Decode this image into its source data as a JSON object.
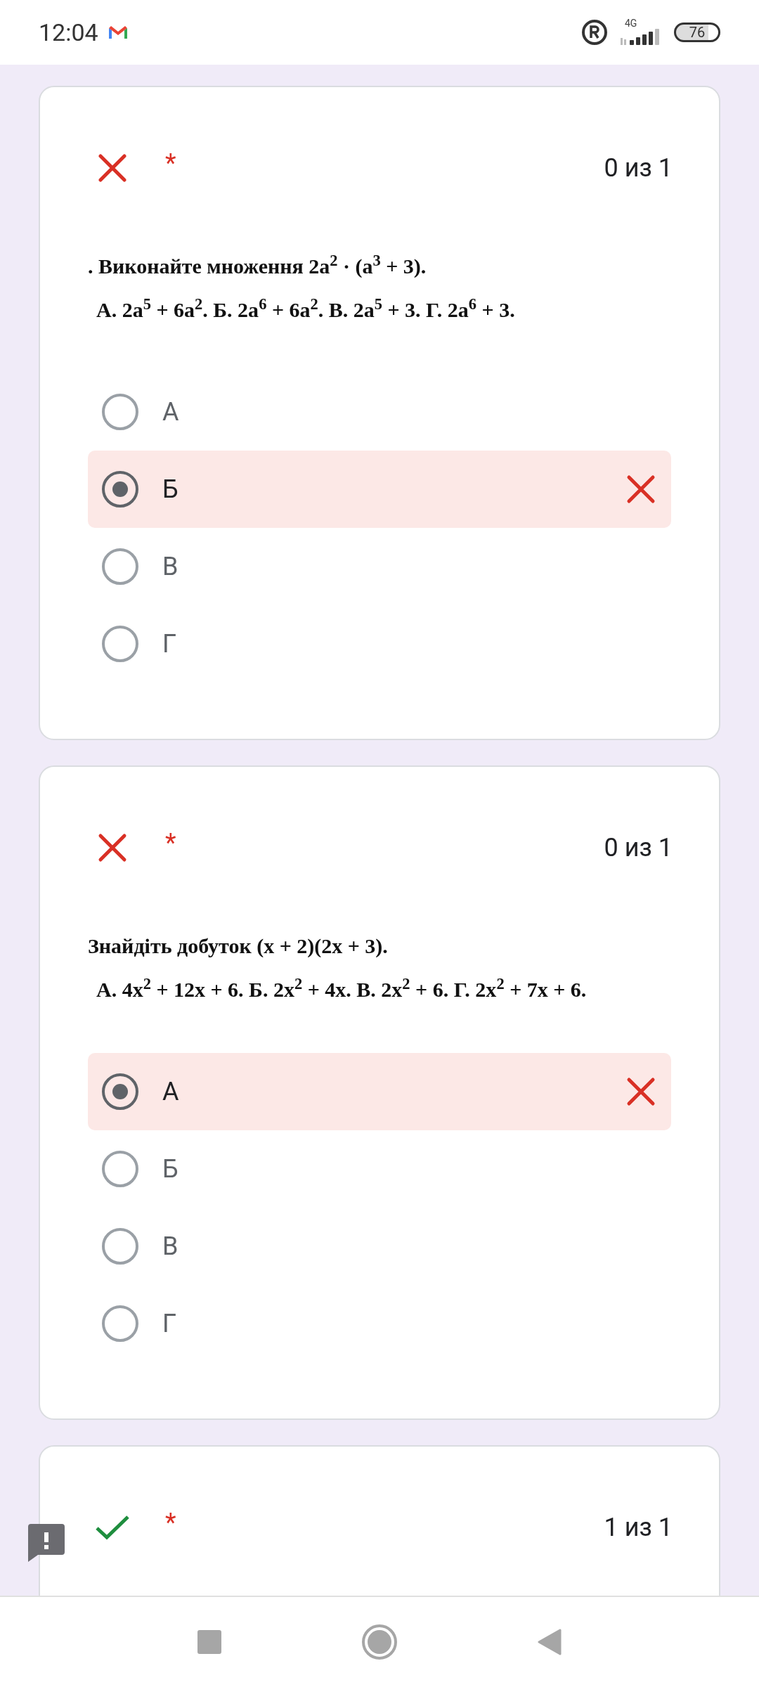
{
  "status_bar": {
    "time": "12:04",
    "network": "4G",
    "battery": "76"
  },
  "questions": [
    {
      "correct": false,
      "required_mark": "*",
      "score": "0 из 1",
      "lines": [
        ". Виконайте множення 2a$^{2}$ · (a$^{3}$ + 3).",
        "А. 2a$^{5}$ + 6a$^{2}$. Б. 2a$^{6}$ + 6a$^{2}$. В. 2a$^{5}$ + 3. Г. 2a$^{6}$ + 3."
      ],
      "options": [
        {
          "label": "А",
          "selected": false
        },
        {
          "label": "Б",
          "selected": true
        },
        {
          "label": "В",
          "selected": false
        },
        {
          "label": "Г",
          "selected": false
        }
      ]
    },
    {
      "correct": false,
      "required_mark": "*",
      "score": "0 из 1",
      "lines": [
        "Знайдіть добуток (x + 2)(2x + 3).",
        "А. 4x$^{2}$ + 12x + 6. Б. 2x$^{2}$ + 4x. В. 2x$^{2}$ + 6. Г. 2x$^{2}$ + 7x + 6."
      ],
      "options": [
        {
          "label": "А",
          "selected": true
        },
        {
          "label": "Б",
          "selected": false
        },
        {
          "label": "В",
          "selected": false
        },
        {
          "label": "Г",
          "selected": false
        }
      ]
    },
    {
      "correct": true,
      "required_mark": "*",
      "score": "1 из 1"
    }
  ]
}
